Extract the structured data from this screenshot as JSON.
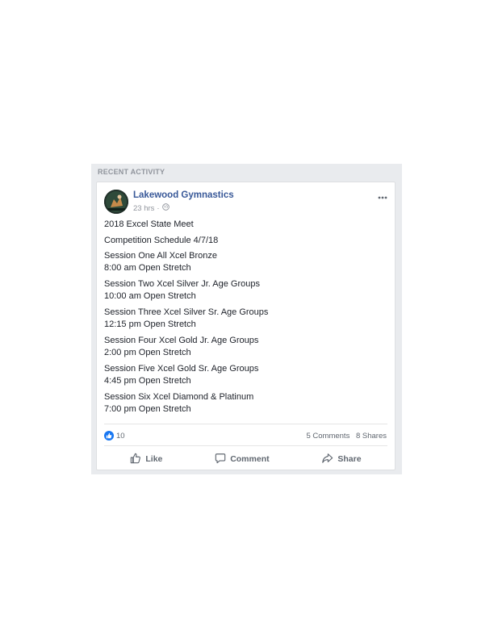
{
  "panel": {
    "title": "RECENT ACTIVITY"
  },
  "post": {
    "page_name": "Lakewood Gymnastics",
    "time": "23 hrs",
    "separator": "·",
    "lines": [
      "2018 Excel State Meet",
      "Competition Schedule 4/7/18"
    ],
    "sessions": [
      {
        "title": "Session One All Xcel Bronze",
        "time": "8:00 am Open Stretch"
      },
      {
        "title": "Session Two Xcel Silver Jr. Age Groups",
        "time": "10:00 am Open Stretch"
      },
      {
        "title": "Session Three Xcel Silver Sr. Age Groups",
        "time": "12:15 pm Open Stretch"
      },
      {
        "title": "Session Four Xcel Gold Jr. Age Groups",
        "time": "2:00 pm Open Stretch"
      },
      {
        "title": "Session Five Xcel Gold Sr. Age Groups",
        "time": "4:45 pm Open Stretch"
      },
      {
        "title": "Session Six Xcel Diamond & Platinum",
        "time": "7:00 pm Open Stretch"
      }
    ],
    "reaction_count": "10",
    "comments": "5 Comments",
    "shares": "8 Shares"
  },
  "actions": {
    "like": "Like",
    "comment": "Comment",
    "share": "Share"
  },
  "colors": {
    "brand_link": "#385898",
    "like_blue": "#1877f2",
    "panel_bg": "#e9ebee"
  },
  "icons": [
    "avatar-photo",
    "globe-icon",
    "more-options-icon",
    "like-reaction-icon",
    "thumbs-up-icon",
    "comment-icon",
    "share-icon"
  ]
}
